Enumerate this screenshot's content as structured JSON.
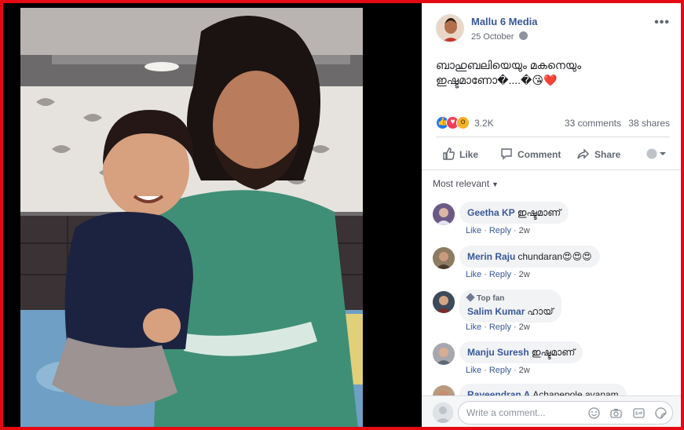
{
  "post": {
    "page_name": "Mallu 6 Media",
    "date": "25 October",
    "caption_line1": "ബാഹുബലിയെയും മകനെയും",
    "caption_line2": "ഇഷ്ടമാണോ�....�😘❤️",
    "reactions_count": "3.2K",
    "comments_count": "33 comments",
    "shares_count": "38 shares"
  },
  "actions": {
    "like": "Like",
    "comment": "Comment",
    "share": "Share"
  },
  "comments_filter": "Most relevant",
  "comment_meta": {
    "like": "Like",
    "reply": "Reply",
    "sep": "·"
  },
  "comments": [
    {
      "name": "Geetha KP",
      "text": "ഇഷ്ടമാണ്",
      "time": "2w"
    },
    {
      "name": "Merin Raju",
      "text": "chundaran😍😍😍",
      "time": "2w"
    },
    {
      "badge": "Top fan",
      "name": "Salim Kumar",
      "text": "ഹായ്",
      "time": "2w"
    },
    {
      "name": "Manju Suresh",
      "text": "ഇഷ്ടമാണ്",
      "time": "2w"
    },
    {
      "name": "Raveendran A",
      "text": "Achanepole avanam"
    }
  ],
  "composer": {
    "placeholder": "Write a comment..."
  },
  "icons": {
    "globe": "globe-icon",
    "more": "more-options-icon",
    "like": "thumbs-up-icon",
    "comment": "speech-bubble-icon",
    "share": "share-arrow-icon",
    "emoji": "smiley-icon",
    "camera": "camera-icon",
    "gif": "gif-icon",
    "sticker": "sticker-icon"
  },
  "colors": {
    "frame": "#e50914",
    "link": "#385898",
    "like": "#2078f4",
    "love": "#f33e58",
    "wow": "#f7b125"
  }
}
